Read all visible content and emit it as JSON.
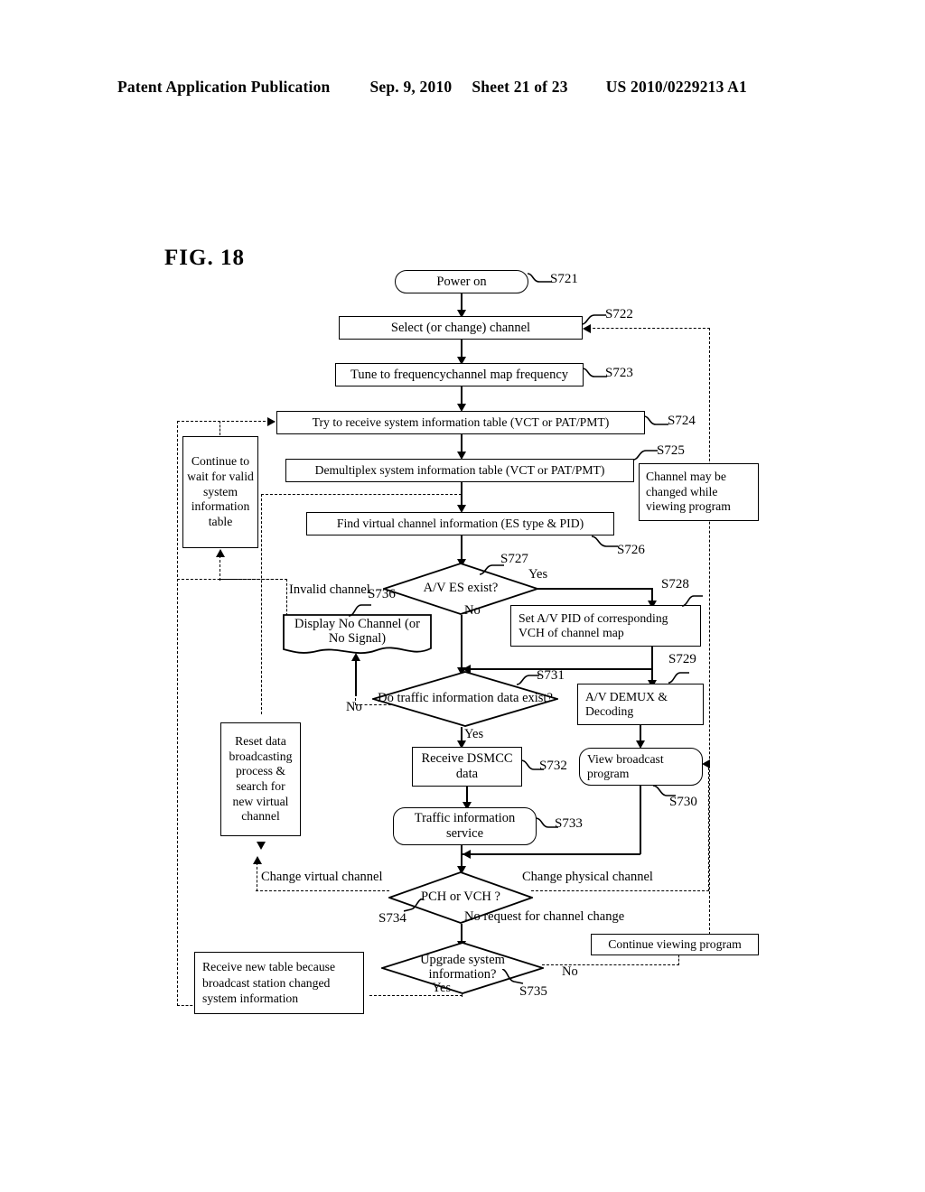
{
  "header": {
    "publication": "Patent Application Publication",
    "date": "Sep. 9, 2010",
    "sheet": "Sheet 21 of 23",
    "number": "US 2010/0229213 A1"
  },
  "figure": {
    "label": "FIG. 18"
  },
  "nodes": {
    "power_on": "Power on",
    "select_channel": "Select (or change) channel",
    "tune_frequency": "Tune to frequencychannel map frequency",
    "try_receive": "Try to receive system information table (VCT or PAT/PMT)",
    "demultiplex": "Demultiplex system information table (VCT or PAT/PMT)",
    "find_vch_info": "Find virtual channel information (ES type & PID)",
    "av_es_exist": "A/V ES exist?",
    "set_av_pid": "Set A/V PID of corresponding VCH of channel map",
    "av_demux": "A/V DEMUX & Decoding",
    "view_broadcast": "View broadcast program",
    "display_no_channel": "Display No Channel (or No Signal)",
    "traffic_exist": "Do traffic information data exist?",
    "receive_dsmcc": "Receive DSMCC data",
    "traffic_service": "Traffic information service",
    "pch_or_vch": "PCH or VCH ?",
    "upgrade_sysinfo": "Upgrade system information?",
    "continue_wait": "Continue to wait for valid system information table",
    "reset_data": "Reset data broadcasting process & search for new virtual channel",
    "receive_new_table": "Receive new table because broadcast station changed system information",
    "channel_may_change": "Channel may be changed while viewing program",
    "continue_viewing": "Continue viewing program"
  },
  "step_refs": {
    "s721": "S721",
    "s722": "S722",
    "s723": "S723",
    "s724": "S724",
    "s725": "S725",
    "s726": "S726",
    "s727": "S727",
    "s728": "S728",
    "s729": "S729",
    "s730": "S730",
    "s731": "S731",
    "s732": "S732",
    "s733": "S733",
    "s734": "S734",
    "s735": "S735",
    "s736": "S736"
  },
  "edge_labels": {
    "av_es_yes": "Yes",
    "av_es_no": "No",
    "invalid_channel": "Invalid channel",
    "traffic_no": "No",
    "traffic_yes": "Yes",
    "change_virtual_channel": "Change virtual channel",
    "change_physical_channel": "Change physical channel",
    "no_request": "No request for channel change",
    "upgrade_yes": "Yes",
    "upgrade_no": "No"
  }
}
